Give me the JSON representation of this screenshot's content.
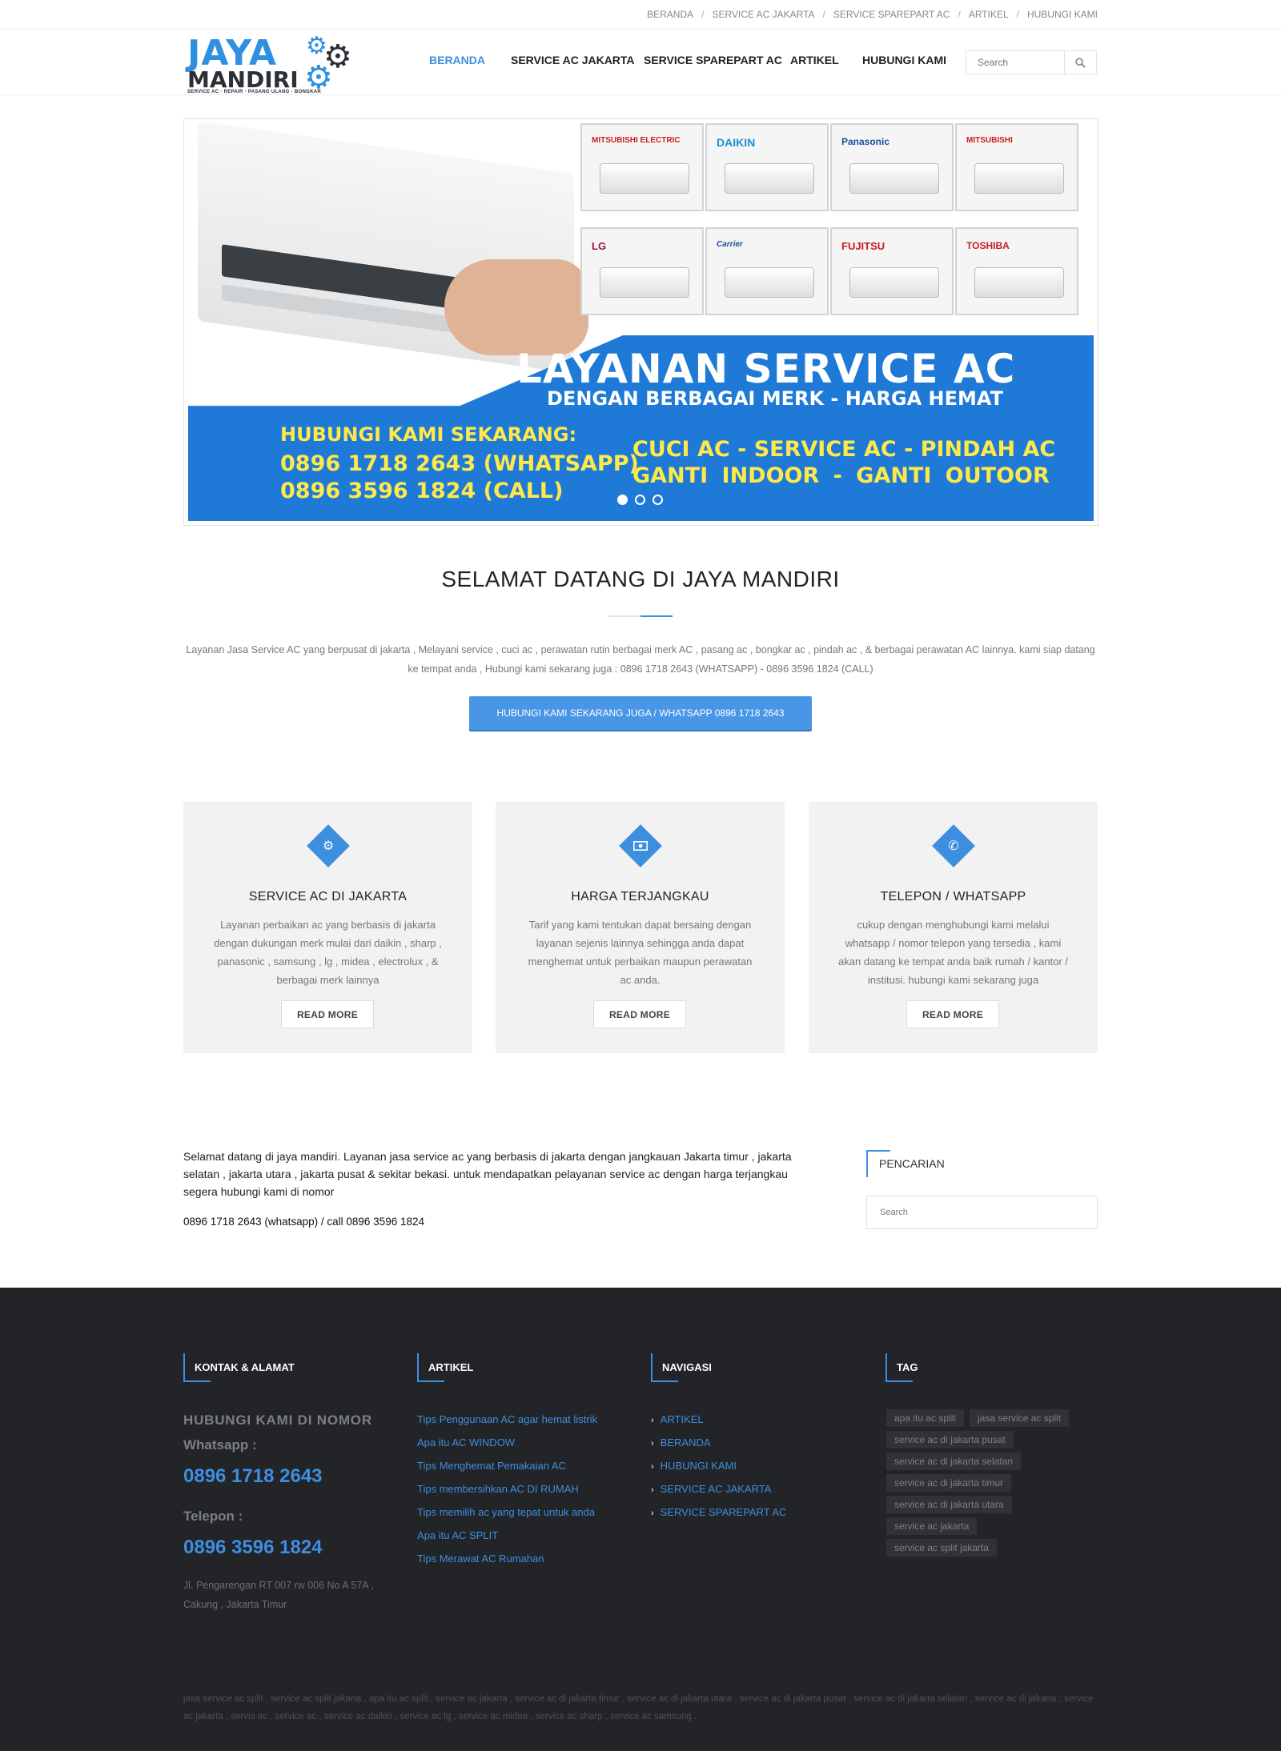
{
  "topbar": {
    "links": [
      "BERANDA",
      "SERVICE AC JAKARTA",
      "SERVICE SPAREPART AC",
      "ARTIKEL",
      "HUBUNGI KAMI"
    ]
  },
  "logo": {
    "line1": "JAYA",
    "line2": "MANDIRI",
    "tagline": "SERVICE AC · REPAIR · PASANG ULANG · BONGKAR"
  },
  "nav": {
    "items": [
      "BERANDA",
      "SERVICE AC JAKARTA",
      "SERVICE SPAREPART AC",
      "ARTIKEL",
      "HUBUNGI KAMI"
    ],
    "active_index": 0,
    "search_placeholder": "Search",
    "accent_color": "#3e8ee0"
  },
  "slider": {
    "brands": [
      "MITSUBISHI ELECTRIC",
      "DAIKIN",
      "Panasonic",
      "MITSUBISHI",
      "LG",
      "Carrier",
      "FUJITSU",
      "TOSHIBA"
    ],
    "title": "LAYANAN SERVICE AC",
    "subtitle": "DENGAN BERBAGAI MERK - HARGA HEMAT",
    "call_title": "HUBUNGI KAMI SEKARANG:",
    "phone1": "0896 1718 2643 (WHATSAPP)",
    "phone2": "0896 3596 1824 (CALL)",
    "services1": "CUCI AC - SERVICE AC - PINDAH AC",
    "services2": "GANTI INDOOR - GANTI OUTOOR",
    "dot_count": 3,
    "active_dot": 0
  },
  "welcome": {
    "title": "SELAMAT DATANG DI JAYA MANDIRI",
    "text": "Layanan Jasa Service AC yang berpusat di jakarta , Melayani service , cuci ac , perawatan rutin berbagai merk AC , pasang ac , bongkar ac , pindah ac , & berbagai perawatan AC lainnya. kami siap datang ke tempat anda , Hubungi kami sekarang juga : 0896 1718 2643 (WHATSAPP) - 0896 3596 1824 (CALL)",
    "cta": "HUBUNGI KAMI SEKARANG JUGA / WHATSAPP 0896 1718 2643"
  },
  "features": [
    {
      "icon": "gear-icon",
      "title": "SERVICE AC DI JAKARTA",
      "text": "Layanan perbaikan ac yang berbasis di jakarta dengan dukungan merk mulai dari daikin , sharp , panasonic , samsung , lg , midea , electrolux , & berbagai merk lainnya",
      "button": "READ MORE"
    },
    {
      "icon": "money-icon",
      "title": "HARGA TERJANGKAU",
      "text": "Tarif yang kami tentukan dapat bersaing dengan layanan sejenis lainnya sehingga anda dapat menghemat untuk perbaikan maupun perawatan ac anda.",
      "button": "READ MORE"
    },
    {
      "icon": "phone-icon",
      "title": "TELEPON / WHATSAPP",
      "text": "cukup dengan menghubungi kami melalui whatsapp / nomor telepon yang tersedia , kami akan datang ke tempat anda baik rumah / kantor / institusi. hubungi kami sekarang juga",
      "button": "READ MORE"
    }
  ],
  "content": {
    "text": "Selamat datang di jaya mandiri. Layanan jasa service ac yang berbasis di jakarta dengan jangkauan Jakarta timur , jakarta selatan , jakarta utara , jakarta pusat & sekitar bekasi. untuk mendapatkan pelayanan service ac dengan harga terjangkau segera hubungi kami di nomor",
    "phones": "0896 1718 2643 (whatsapp) / call 0896 3596 1824"
  },
  "sidebar": {
    "title": "PENCARIAN",
    "search_placeholder": "Search"
  },
  "footer": {
    "contact": {
      "title": "KONTAK & ALAMAT",
      "head": "HUBUNGI KAMI DI NOMOR",
      "label1": "Whatsapp :",
      "phone1": "0896 1718 2643",
      "label2": "Telepon :",
      "phone2": "0896 3596 1824",
      "address": "Jl. Pengarengan RT 007 rw 006 No A 57A , Cakung , Jakarta Timur"
    },
    "articles": {
      "title": "ARTIKEL",
      "items": [
        "Tips Penggunaan AC agar hemat listrik",
        "Apa itu AC WINDOW",
        "Tips Menghemat Pemakaian AC",
        "Tips membersihkan AC DI RUMAH",
        "Tips memilih ac yang tepat untuk anda",
        "Apa itu AC SPLIT",
        "Tips Merawat AC Rumahan"
      ]
    },
    "navigasi": {
      "title": "NAVIGASI",
      "items": [
        "ARTIKEL",
        "BERANDA",
        "HUBUNGI KAMI",
        "SERVICE AC JAKARTA",
        "SERVICE SPAREPART AC"
      ]
    },
    "tags": {
      "title": "TAG",
      "items": [
        "apa itu ac split",
        "jasa service ac split",
        "service ac di jakarta pusat",
        "service ac di jakarta selatan",
        "service ac di jakarta timur",
        "service ac di jakarta utara",
        "service ac jakarta",
        "service ac split jakarta"
      ]
    },
    "bottom_text": "jasa service ac split , service ac split jakarta , apa itu ac split , service ac jakarta , service ac di jakarta timur , service ac di jakarta utara , service ac di jakarta pusat , service ac di jakarta selatan , service ac di jakarta , service ac jakarta , servis ac , service ac , service ac daikin , service ac lg , service ac midea , service ac sharp , service ac samsung ."
  }
}
